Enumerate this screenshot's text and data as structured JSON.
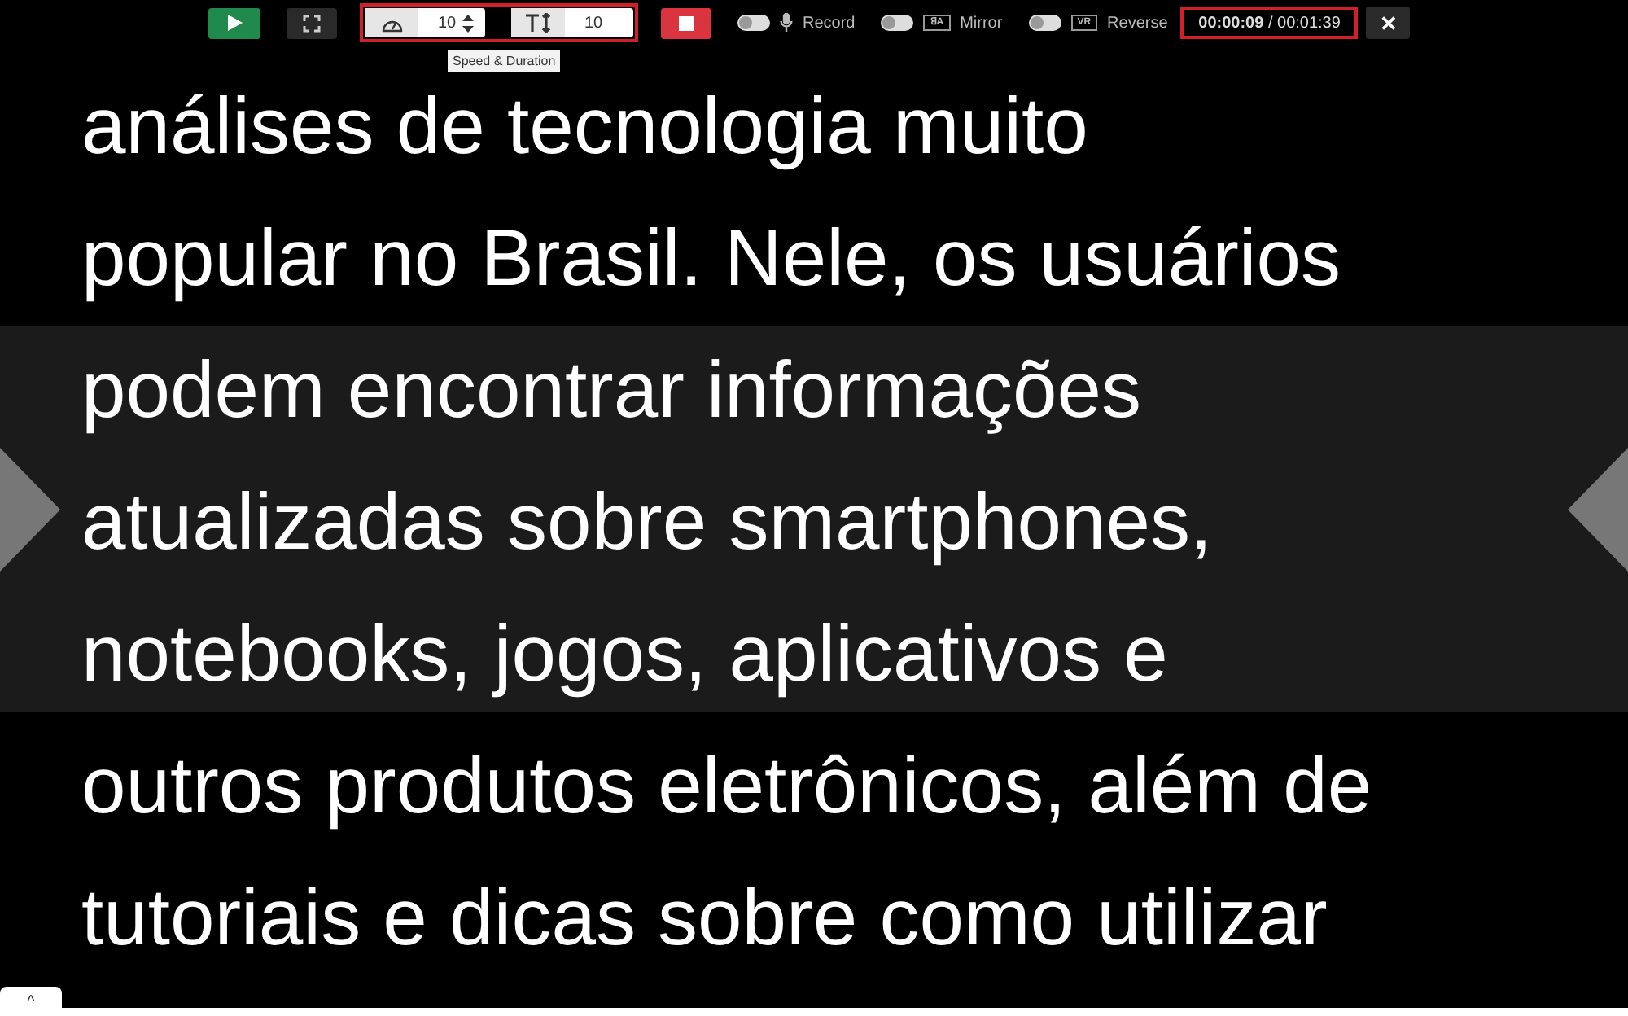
{
  "toolbar": {
    "speed": {
      "value": "10"
    },
    "text_size": {
      "value": "10"
    },
    "tooltip": "Speed & Duration",
    "toggles": [
      {
        "kind": "mic",
        "label": "Record",
        "on": false
      },
      {
        "kind": "mirror",
        "icon_text": "ꓭA",
        "label": "Mirror",
        "on": false
      },
      {
        "kind": "reverse",
        "icon_text": "VR",
        "label": "Reverse",
        "on": false
      }
    ],
    "time": {
      "elapsed": "00:00:09",
      "total": "/ 00:01:39"
    },
    "close": "✕"
  },
  "script_lines": [
    "análises de tecnologia muito",
    "popular no Brasil. Nele, os usuários",
    "podem encontrar informações",
    "atualizadas sobre smartphones,",
    "notebooks, jogos, aplicativos e",
    "outros produtos eletrônicos, além de",
    "tutoriais e dicas sobre como utilizar"
  ],
  "bottom_tab": {
    "icon": "^"
  }
}
